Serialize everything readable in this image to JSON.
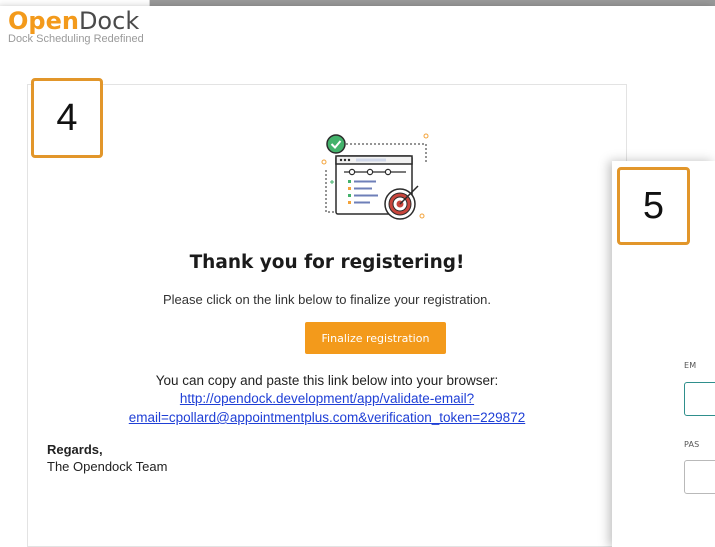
{
  "brand": {
    "name_strong": "Open",
    "name_rest": "Dock",
    "tagline": "Dock Scheduling Redefined"
  },
  "steps": {
    "step_4": "4",
    "step_5": "5"
  },
  "email": {
    "title": "Thank you for registering!",
    "instruction": "Please click on the link below to finalize your registration.",
    "button_label": "Finalize registration",
    "copy_instruction": "You can copy and paste this link below into your browser:",
    "link_line_1": "http://opendock.development/app/validate-email?",
    "link_line_2": "email=cpollard@appointmentplus.com&verification_token=229872",
    "regards": "Regards,",
    "team": "The Opendock Team"
  },
  "login": {
    "email_label": "EM",
    "password_label": "PAS"
  },
  "colors": {
    "brand_orange": "#f39a1b",
    "step_border": "#e2962a",
    "link_blue": "#1f3fd6",
    "success_green": "#43b26b",
    "target_red": "#c8453c"
  }
}
